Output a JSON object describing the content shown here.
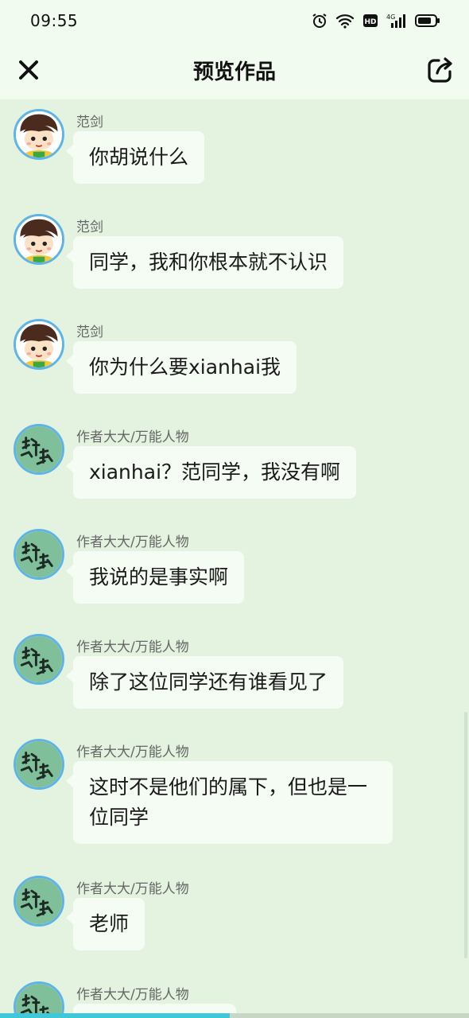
{
  "status_bar": {
    "time": "09:55",
    "network": "4G"
  },
  "header": {
    "title": "预览作品"
  },
  "messages": [
    {
      "sender": "范剑",
      "text": "你胡说什么",
      "avatar": "boy-avatar"
    },
    {
      "sender": "范剑",
      "text": "同学，我和你根本就不认识",
      "avatar": "boy-avatar"
    },
    {
      "sender": "范剑",
      "text": "你为什么要xianhai我",
      "avatar": "boy-avatar"
    },
    {
      "sender": "作者大大/万能人物",
      "text": "xianhai？范同学，我没有啊",
      "avatar": "calligraphy-avatar"
    },
    {
      "sender": "作者大大/万能人物",
      "text": "我说的是事实啊",
      "avatar": "calligraphy-avatar"
    },
    {
      "sender": "作者大大/万能人物",
      "text": "除了这位同学还有谁看见了",
      "avatar": "calligraphy-avatar"
    },
    {
      "sender": "作者大大/万能人物",
      "text": "这时不是他们的属下，但也是一位同学",
      "avatar": "calligraphy-avatar"
    },
    {
      "sender": "作者大大/万能人物",
      "text": "老师",
      "avatar": "calligraphy-avatar"
    },
    {
      "sender": "作者大大/万能人物",
      "text": "",
      "avatar": "calligraphy-avatar"
    }
  ],
  "playback": {
    "progress": 0.49
  },
  "colors": {
    "background": "#e3f3e0",
    "header": "#f2fbef",
    "bubble": "#f5fcf4",
    "avatar_ring": "#5fb4e6",
    "progress": "#3ec8d8"
  }
}
